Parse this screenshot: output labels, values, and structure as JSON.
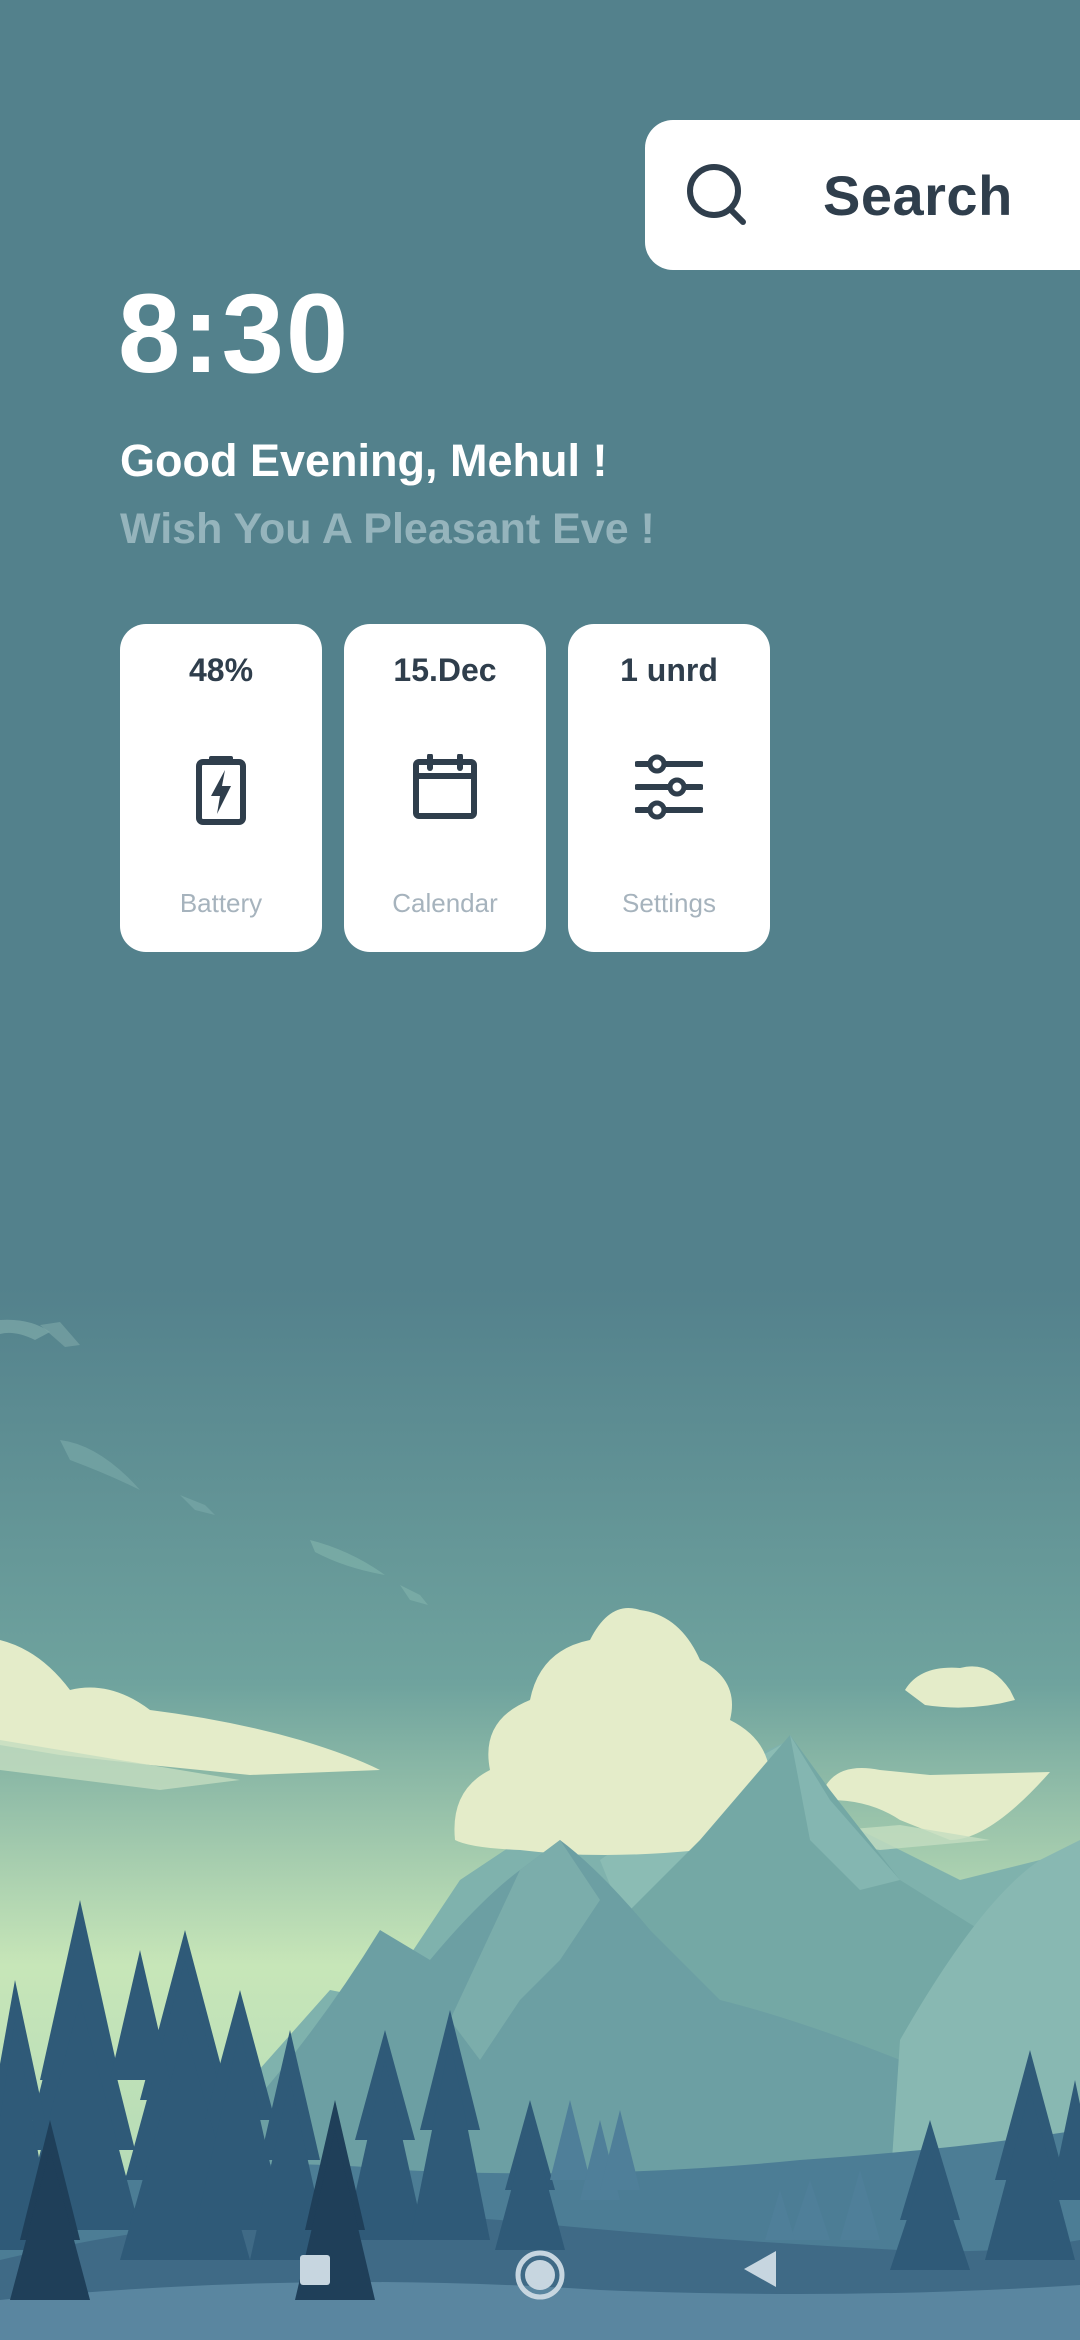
{
  "search": {
    "label": "Search",
    "icon": "search-icon"
  },
  "clock": {
    "time": "8:30"
  },
  "greeting": {
    "title": "Good Evening, Mehul !",
    "subtitle": "Wish You A Pleasant Eve !"
  },
  "tiles": [
    {
      "value": "48%",
      "label": "Battery",
      "icon": "battery-charging-icon"
    },
    {
      "value": "15.Dec",
      "label": "Calendar",
      "icon": "calendar-icon"
    },
    {
      "value": "1 unrd",
      "label": "Settings",
      "icon": "sliders-icon"
    }
  ],
  "navbar": {
    "buttons": [
      "recent-apps-button",
      "home-button",
      "back-button"
    ]
  },
  "colors": {
    "background": "#53818c",
    "text_dark": "#2f3e4c",
    "subtitle": "#95b4bc",
    "tile_label": "#a6b3bd"
  }
}
